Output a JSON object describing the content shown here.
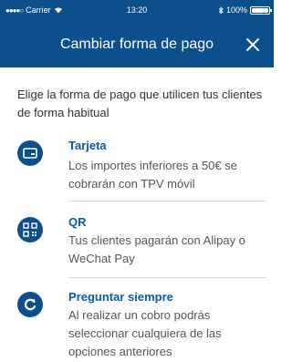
{
  "status_bar": {
    "carrier": "Carrier",
    "time": "13:20",
    "battery": "100%",
    "battery_level": 1.0
  },
  "header": {
    "title": "Cambiar forma de pago"
  },
  "intro": "Elige la forma de pago que utilicen tus clientes de forma habitual",
  "options": [
    {
      "title": "Tarjeta",
      "description": "Los importes inferiores a 50€ se cobrarán con TPV móvil",
      "icon": "card-icon"
    },
    {
      "title": "QR",
      "description": "Tus clientes pagarán con Alipay o WeChat Pay",
      "icon": "qr-code-icon"
    },
    {
      "title": "Preguntar siempre",
      "description": "Al realizar un cobro podrás seleccionar cualquiera de las opciones anteriores",
      "icon": "refresh-icon"
    }
  ],
  "colors": {
    "brand": "#0b4f8c",
    "link": "#0b5ca8"
  }
}
